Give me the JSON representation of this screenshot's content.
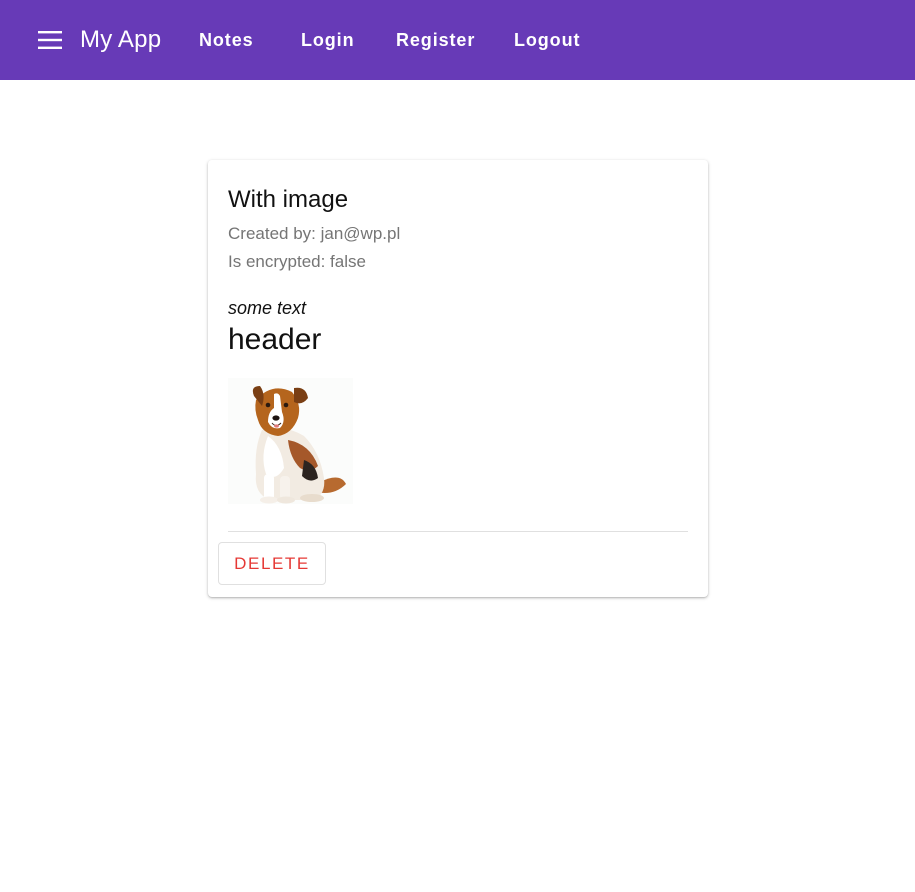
{
  "appbar": {
    "title": "My App",
    "color": "#673ab7",
    "menu_icon": "hamburger-menu-icon",
    "nav": [
      "Notes",
      "Login",
      "Register",
      "Logout"
    ]
  },
  "note": {
    "title": "With image",
    "created_by": "Created by: jan@wp.pl",
    "is_encrypted": "Is encrypted: false",
    "italic_text": "some text",
    "header_text": "header",
    "image": "dog-photo",
    "delete_label": "DELETE",
    "delete_color": "#e53935"
  }
}
